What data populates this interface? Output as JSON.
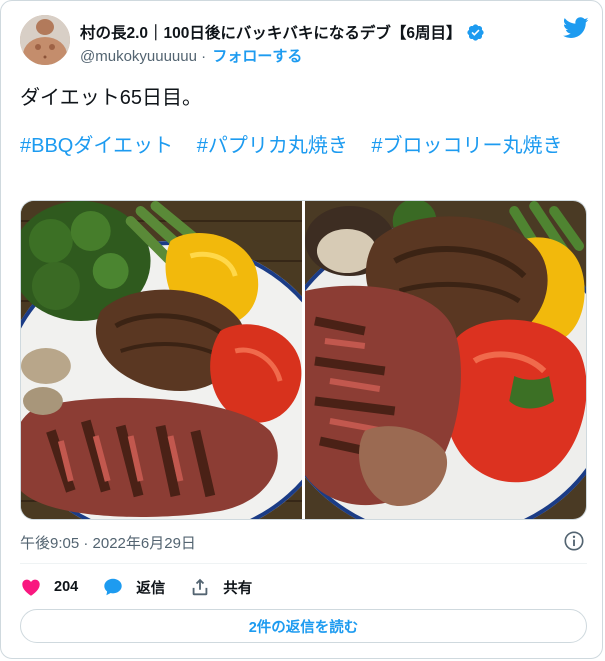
{
  "tweet": {
    "author": {
      "display_name": "村の長2.0｜100日後にバッキバキになるデブ【6周目】",
      "handle": "@mukokyuuuuuu",
      "separator": "·",
      "follow_label": "フォローする",
      "verified": true
    },
    "text": "ダイエット65日目。",
    "hashtags": [
      "#BBQダイエット",
      "#パプリカ丸焼き",
      "#ブロッコリー丸焼き"
    ],
    "timestamp": "午後9:05 · 2022年6月29日",
    "actions": {
      "like_count": "204",
      "reply_label": "返信",
      "share_label": "共有"
    },
    "read_replies_label": "2件の返信を読む"
  },
  "icons": {
    "brand": "twitter-bird-icon",
    "verified": "verified-badge-icon",
    "info": "info-icon",
    "like": "heart-icon",
    "reply": "reply-bubble-icon",
    "share": "share-icon"
  },
  "colors": {
    "accent": "#1d9bf0",
    "like": "#f91880",
    "text": "#0f1419",
    "muted": "#536471",
    "border": "#cfd9de"
  }
}
